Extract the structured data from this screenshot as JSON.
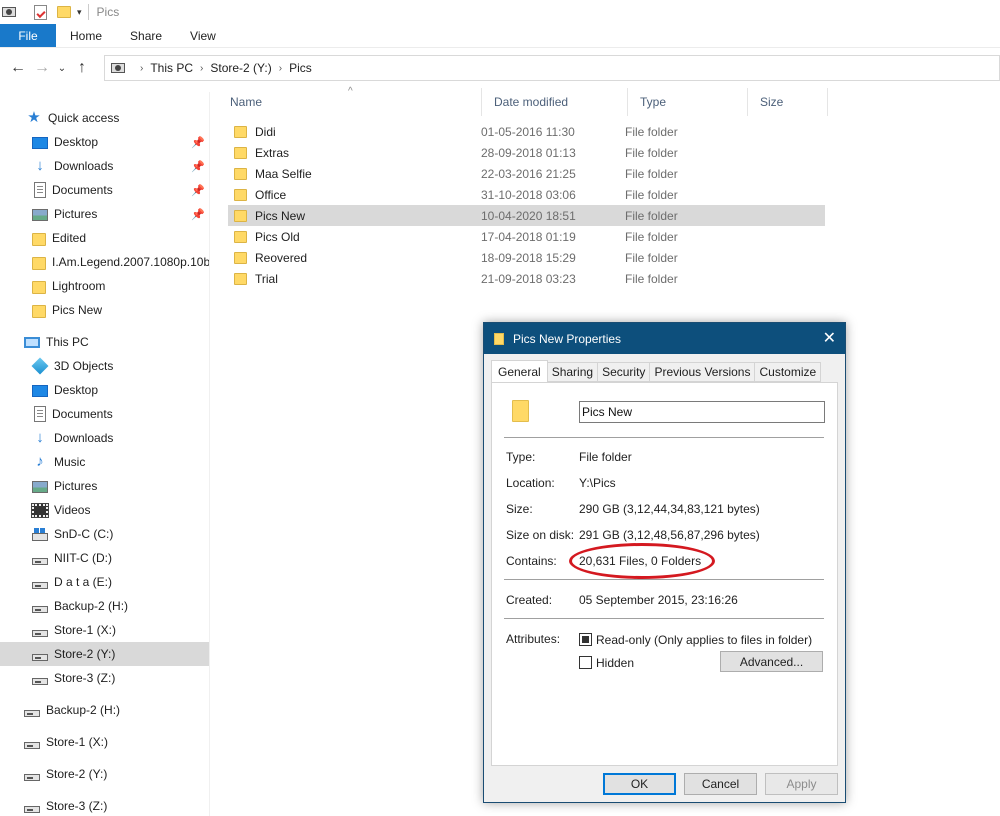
{
  "window": {
    "title": "Pics"
  },
  "ribbon": {
    "file": "File",
    "tabs": [
      "Home",
      "Share",
      "View"
    ]
  },
  "address": {
    "crumbs": [
      "This PC",
      "Store-2 (Y:)",
      "Pics"
    ]
  },
  "sidebar": {
    "items": [
      {
        "label": "Quick access",
        "icon": "star-icon"
      },
      {
        "label": "Desktop",
        "icon": "desktop-icon",
        "pinned": true
      },
      {
        "label": "Downloads",
        "icon": "download-icon",
        "pinned": true
      },
      {
        "label": "Documents",
        "icon": "documents-icon",
        "pinned": true
      },
      {
        "label": "Pictures",
        "icon": "pictures-icon",
        "pinned": true
      },
      {
        "label": "Edited",
        "icon": "folder-icon"
      },
      {
        "label": "I.Am.Legend.2007.1080p.10bit",
        "icon": "folder-icon"
      },
      {
        "label": "Lightroom",
        "icon": "folder-icon"
      },
      {
        "label": "Pics New",
        "icon": "folder-icon"
      },
      {
        "label": "This PC",
        "icon": "computer-icon"
      },
      {
        "label": "3D Objects",
        "icon": "3d-objects-icon"
      },
      {
        "label": "Desktop",
        "icon": "desktop-icon"
      },
      {
        "label": "Documents",
        "icon": "documents-icon"
      },
      {
        "label": "Downloads",
        "icon": "download-icon"
      },
      {
        "label": "Music",
        "icon": "music-icon"
      },
      {
        "label": "Pictures",
        "icon": "pictures-icon"
      },
      {
        "label": "Videos",
        "icon": "videos-icon"
      },
      {
        "label": "SnD-C (C:)",
        "icon": "system-drive-icon"
      },
      {
        "label": "NIIT-C (D:)",
        "icon": "drive-icon"
      },
      {
        "label": "D a t a (E:)",
        "icon": "drive-icon"
      },
      {
        "label": "Backup-2 (H:)",
        "icon": "drive-icon"
      },
      {
        "label": "Store-1 (X:)",
        "icon": "drive-icon"
      },
      {
        "label": "Store-2 (Y:)",
        "icon": "drive-icon",
        "selected": true
      },
      {
        "label": "Store-3 (Z:)",
        "icon": "drive-icon"
      },
      {
        "label": "Backup-2 (H:)",
        "icon": "drive-icon"
      },
      {
        "label": "Store-1 (X:)",
        "icon": "drive-icon"
      },
      {
        "label": "Store-2 (Y:)",
        "icon": "drive-icon"
      },
      {
        "label": "Store-3 (Z:)",
        "icon": "drive-icon"
      }
    ]
  },
  "filelist": {
    "columns": [
      "Name",
      "Date modified",
      "Type",
      "Size"
    ],
    "rows": [
      {
        "name": "Didi",
        "date": "01-05-2016 11:30",
        "type": "File folder"
      },
      {
        "name": "Extras",
        "date": "28-09-2018 01:13",
        "type": "File folder"
      },
      {
        "name": "Maa Selfie",
        "date": "22-03-2016 21:25",
        "type": "File folder"
      },
      {
        "name": "Office",
        "date": "31-10-2018 03:06",
        "type": "File folder"
      },
      {
        "name": "Pics New",
        "date": "10-04-2020 18:51",
        "type": "File folder",
        "selected": true
      },
      {
        "name": "Pics Old",
        "date": "17-04-2018 01:19",
        "type": "File folder"
      },
      {
        "name": "Reovered",
        "date": "18-09-2018 15:29",
        "type": "File folder"
      },
      {
        "name": "Trial",
        "date": "21-09-2018 03:23",
        "type": "File folder"
      }
    ]
  },
  "dialog": {
    "title": "Pics New Properties",
    "close": "✕",
    "tabs": [
      "General",
      "Sharing",
      "Security",
      "Previous Versions",
      "Customize"
    ],
    "name_value": "Pics New",
    "type_label": "Type:",
    "type_value": "File folder",
    "location_label": "Location:",
    "location_value": "Y:\\Pics",
    "size_label": "Size:",
    "size_value": "290 GB (3,12,44,34,83,121 bytes)",
    "size_on_disk_label": "Size on disk:",
    "size_on_disk_value": "291 GB (3,12,48,56,87,296 bytes)",
    "contains_label": "Contains:",
    "contains_value": "20,631 Files, 0 Folders",
    "created_label": "Created:",
    "created_value": "05 September 2015, 23:16:26",
    "attributes_label": "Attributes:",
    "readonly_label": "Read-only (Only applies to files in folder)",
    "hidden_label": "Hidden",
    "advanced_button": "Advanced...",
    "ok_button": "OK",
    "cancel_button": "Cancel",
    "apply_button": "Apply"
  },
  "colors": {
    "file_tab": "#1979ca",
    "dialog_title": "#0d4f7c",
    "highlight": "#d41920",
    "selection": "#d9d9d9"
  }
}
